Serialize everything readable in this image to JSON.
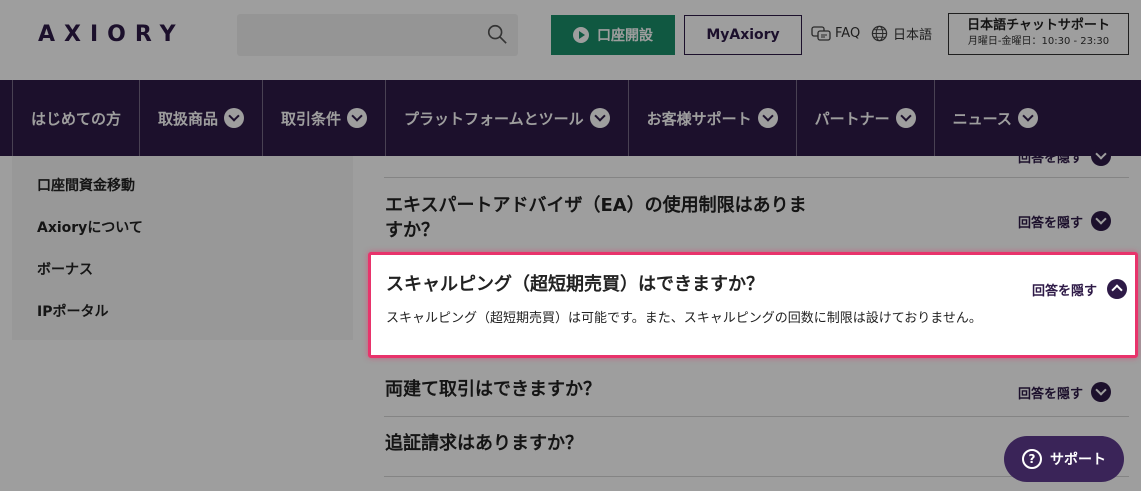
{
  "header": {
    "logo": "AXIORY",
    "open_account_label": "口座開設",
    "my_axiory_label": "MyAxiory",
    "faq_label": "FAQ",
    "language_label": "日本語",
    "chat_title": "日本語チャットサポート",
    "chat_hours": "月曜日-金曜日：10:30 - 23:30"
  },
  "nav": {
    "items": [
      {
        "label": "はじめての方",
        "has_dropdown": false
      },
      {
        "label": "取扱商品",
        "has_dropdown": true
      },
      {
        "label": "取引条件",
        "has_dropdown": true
      },
      {
        "label": "プラットフォームとツール",
        "has_dropdown": true
      },
      {
        "label": "お客様サポート",
        "has_dropdown": true
      },
      {
        "label": "パートナー",
        "has_dropdown": true
      },
      {
        "label": "ニュース",
        "has_dropdown": true
      }
    ]
  },
  "sidebar": {
    "items": [
      {
        "label": "口座間資金移動"
      },
      {
        "label": "Axioryについて"
      },
      {
        "label": "ボーナス"
      },
      {
        "label": "IPポータル"
      }
    ]
  },
  "faq": {
    "hide_label": "回答を隠す",
    "items": [
      {
        "question": "",
        "cut_off": true
      },
      {
        "question_line1": "エキスパートアドバイザ（EA）の使用制限はありま",
        "question_line2": "すか？"
      },
      {
        "question": "スキャルピング（超短期売買）はできますか？",
        "answer": "スキャルピング（超短期売買）は可能です。また、スキャルピングの回数に制限は設けておりません。",
        "expanded": true,
        "highlighted": true
      },
      {
        "question": "両建て取引はできますか？"
      },
      {
        "question": "追証請求はありますか？"
      }
    ]
  },
  "support_button": {
    "label": "サポート"
  },
  "colors": {
    "brand_purple": "#2e1a47",
    "green_button": "#1b8f6a",
    "highlight_border": "#e8336b"
  },
  "icons": [
    "search-icon",
    "play-circle-icon",
    "faq-icon",
    "globe-icon",
    "chevron-down-icon",
    "chevron-up-icon",
    "question-circle-icon"
  ]
}
